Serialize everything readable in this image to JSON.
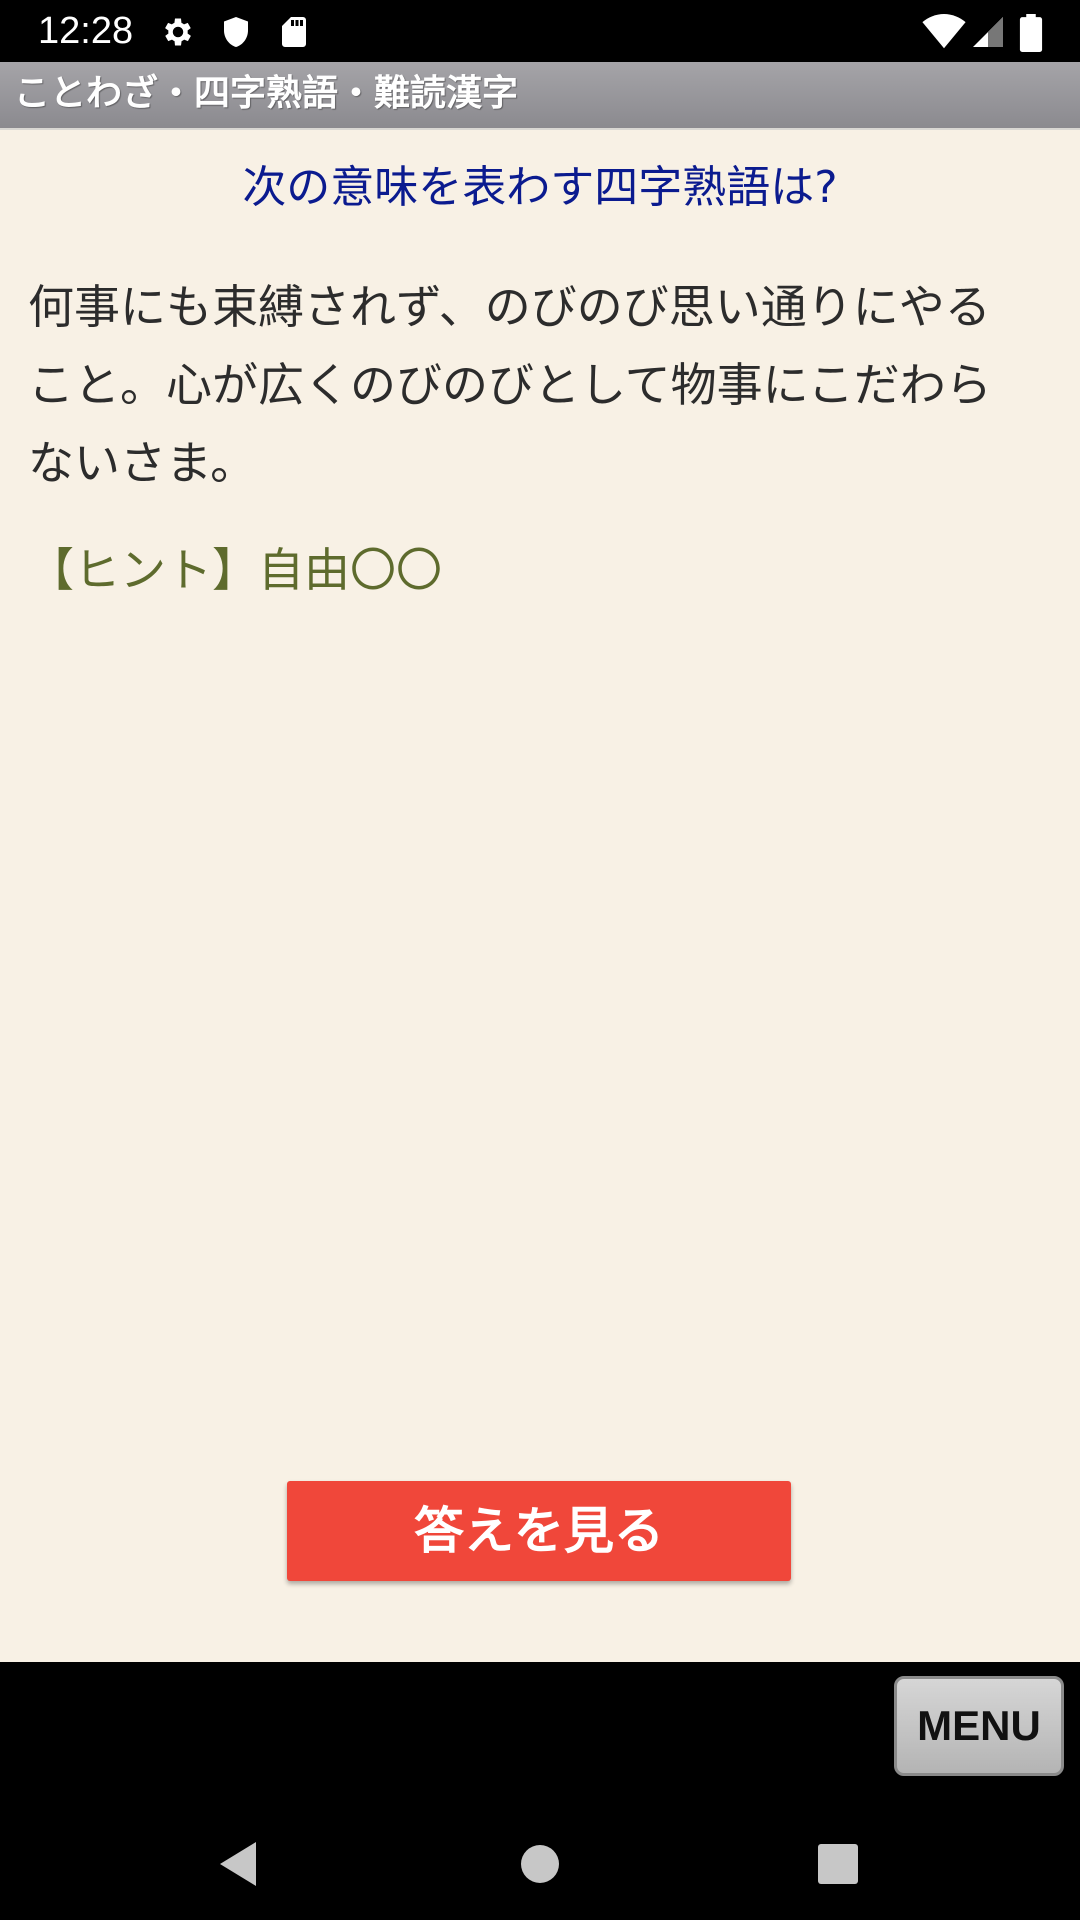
{
  "status_bar": {
    "time": "12:28",
    "icons": [
      "settings-icon",
      "shield-icon",
      "sd-card-icon",
      "wifi-icon",
      "signal-icon",
      "battery-icon"
    ]
  },
  "app_bar": {
    "title": "ことわざ・四字熟語・難読漢字",
    "color": "#9b9a9e"
  },
  "quiz": {
    "question": "次の意味を表わす四字熟語は?",
    "meaning": "何事にも束縛されず、のびのび思い通りにやること。心が広くのびのびとして物事にこだわらないさま。",
    "hint": "【ヒント】自由〇〇",
    "answer_button_label": "答えを見る"
  },
  "menu_button_label": "MENU",
  "nav": {
    "items": [
      "back-icon",
      "home-icon",
      "recents-icon"
    ]
  },
  "colors": {
    "background": "#f8f1e5",
    "question_text": "#0b1b8f",
    "hint_text": "#5e6b2d",
    "answer_button": "#f0473a"
  }
}
